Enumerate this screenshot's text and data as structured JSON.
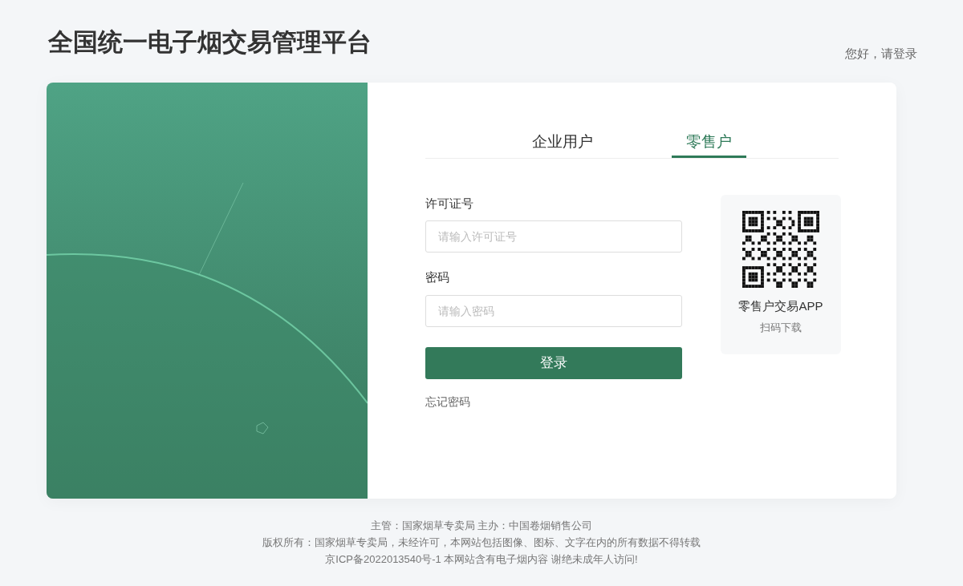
{
  "header": {
    "title": "全国统一电子烟交易管理平台",
    "greeting": "您好，请登录"
  },
  "tabs": [
    {
      "label": "企业用户",
      "selected": false
    },
    {
      "label": "零售户",
      "selected": true
    }
  ],
  "fields": [
    {
      "label": "许可证号",
      "placeholder": "请输入许可证号"
    },
    {
      "label": "密码",
      "placeholder": "请输入密码"
    }
  ],
  "login_button": "登录",
  "forgot_link": "忘记密码",
  "qr": {
    "title": "零售户交易APP",
    "caption": "扫码下载"
  },
  "footer": [
    "主管：国家烟草专卖局 主办：中国卷烟销售公司",
    "版权所有：国家烟草专卖局，未经许可，本网站包括图像、图标、文字在内的所有数据不得转载",
    "京ICP备2022013540号-1 本网站含有电子烟内容 谢绝未成年人访问!"
  ]
}
